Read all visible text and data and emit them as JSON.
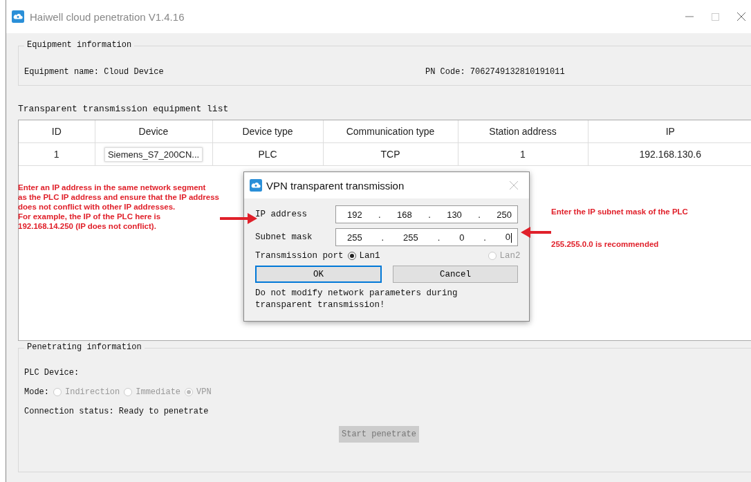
{
  "window": {
    "title": "Haiwell cloud penetration V1.4.16"
  },
  "equipment_information": {
    "title": "Equipment information",
    "name_text": "Equipment name: Cloud Device",
    "pn_text": "PN Code: 7062749132810191011"
  },
  "equipment_list": {
    "title": "Transparent transmission equipment list",
    "columns": [
      "ID",
      "Device",
      "Device type",
      "Communication type",
      "Station address",
      "IP"
    ],
    "rows": [
      [
        "1",
        "Siemens_S7_200CN...",
        "PLC",
        "TCP",
        "1",
        "192.168.130.6"
      ]
    ]
  },
  "annotations": {
    "left_lines": [
      "Enter an IP address in the same network segment",
      "as the PLC IP address and ensure that the IP address",
      "does not conflict with other IP addresses.",
      "For example, the IP of the PLC here is",
      "192.168.14.250 (IP does not conflict)."
    ],
    "right": [
      "Enter the IP subnet mask of the PLC",
      "255.255.0.0 is recommended"
    ]
  },
  "dialog": {
    "title": "VPN transparent transmission",
    "fields": [
      {
        "label": "IP address",
        "octets": [
          "192",
          "168",
          "130",
          "250"
        ],
        "separators": [
          ".",
          ".",
          "."
        ]
      },
      {
        "label": "Subnet mask",
        "octets": [
          "255",
          "255",
          "0",
          "0"
        ],
        "separators": [
          ".",
          ".",
          "."
        ]
      }
    ],
    "port": {
      "label": "Transmission port",
      "options": [
        {
          "label": "Lan1",
          "selected": true,
          "disabled": false
        },
        {
          "label": "Lan2",
          "selected": false,
          "disabled": true
        }
      ]
    },
    "buttons": [
      {
        "label": "OK",
        "focused": true
      },
      {
        "label": "Cancel",
        "focused": false
      }
    ],
    "note": "Do not modify network parameters during transparent transmission!"
  },
  "penetrating_information": {
    "title": "Penetrating information",
    "plc_device": "PLC Device:",
    "mode": {
      "label": "Mode:",
      "options": [
        {
          "label": "Indirection",
          "selected": false,
          "disabled": true
        },
        {
          "label": "Immediate",
          "selected": false,
          "disabled": true
        },
        {
          "label": "VPN",
          "selected": true,
          "disabled": true
        }
      ]
    },
    "connection_status": "Connection status: Ready to penetrate",
    "start_button": {
      "label": "Start penetrate",
      "disabled": true
    }
  }
}
